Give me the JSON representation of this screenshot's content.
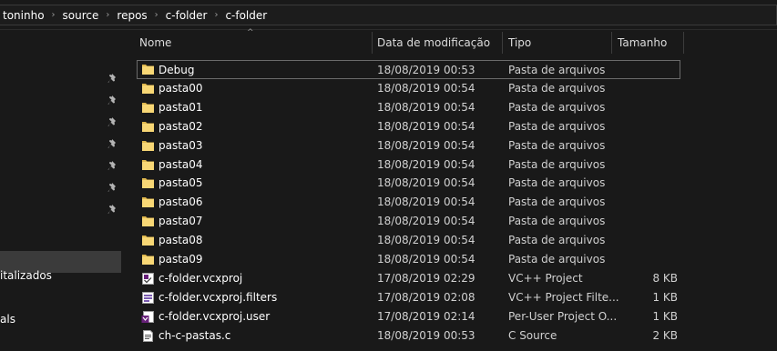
{
  "breadcrumb": [
    "toninho",
    "source",
    "repos",
    "c-folder",
    "c-folder"
  ],
  "columns": {
    "name": "Nome",
    "modified": "Data de modificação",
    "type": "Tipo",
    "size": "Tamanho"
  },
  "nav": {
    "label_1": "italizados",
    "label_2": "als",
    "pinned_count": 7
  },
  "files": [
    {
      "name": "Debug",
      "modified": "18/08/2019 00:53",
      "type": "Pasta de arquivos",
      "size": "",
      "icon": "folder-icon"
    },
    {
      "name": "pasta00",
      "modified": "18/08/2019 00:54",
      "type": "Pasta de arquivos",
      "size": "",
      "icon": "folder-icon"
    },
    {
      "name": "pasta01",
      "modified": "18/08/2019 00:54",
      "type": "Pasta de arquivos",
      "size": "",
      "icon": "folder-icon"
    },
    {
      "name": "pasta02",
      "modified": "18/08/2019 00:54",
      "type": "Pasta de arquivos",
      "size": "",
      "icon": "folder-icon"
    },
    {
      "name": "pasta03",
      "modified": "18/08/2019 00:54",
      "type": "Pasta de arquivos",
      "size": "",
      "icon": "folder-icon"
    },
    {
      "name": "pasta04",
      "modified": "18/08/2019 00:54",
      "type": "Pasta de arquivos",
      "size": "",
      "icon": "folder-icon"
    },
    {
      "name": "pasta05",
      "modified": "18/08/2019 00:54",
      "type": "Pasta de arquivos",
      "size": "",
      "icon": "folder-icon"
    },
    {
      "name": "pasta06",
      "modified": "18/08/2019 00:54",
      "type": "Pasta de arquivos",
      "size": "",
      "icon": "folder-icon"
    },
    {
      "name": "pasta07",
      "modified": "18/08/2019 00:54",
      "type": "Pasta de arquivos",
      "size": "",
      "icon": "folder-icon"
    },
    {
      "name": "pasta08",
      "modified": "18/08/2019 00:54",
      "type": "Pasta de arquivos",
      "size": "",
      "icon": "folder-icon"
    },
    {
      "name": "pasta09",
      "modified": "18/08/2019 00:54",
      "type": "Pasta de arquivos",
      "size": "",
      "icon": "folder-icon"
    },
    {
      "name": "c-folder.vcxproj",
      "modified": "17/08/2019 02:29",
      "type": "VC++ Project",
      "size": "8 KB",
      "icon": "vcxproj-file-icon"
    },
    {
      "name": "c-folder.vcxproj.filters",
      "modified": "17/08/2019 02:08",
      "type": "VC++ Project Filte...",
      "size": "1 KB",
      "icon": "filters-file-icon"
    },
    {
      "name": "c-folder.vcxproj.user",
      "modified": "17/08/2019 02:14",
      "type": "Per-User Project O...",
      "size": "1 KB",
      "icon": "user-file-icon"
    },
    {
      "name": "ch-c-pastas.c",
      "modified": "18/08/2019 00:53",
      "type": "C Source",
      "size": "2 KB",
      "icon": "c-source-file-icon"
    }
  ],
  "colors": {
    "background": "#191919",
    "folder": "#f8d775",
    "text": "#ffffff",
    "selection_border": "#6a6a6a"
  }
}
